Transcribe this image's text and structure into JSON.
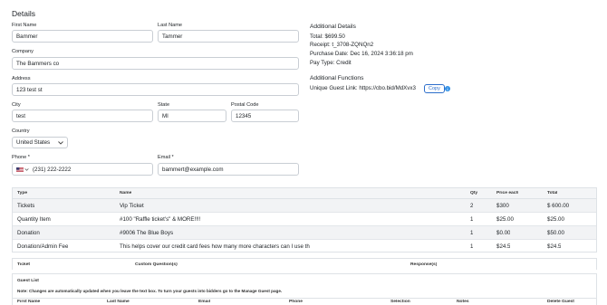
{
  "page": {
    "title": "Details"
  },
  "form": {
    "first_name": {
      "label": "First Name",
      "value": "Bammer"
    },
    "last_name": {
      "label": "Last Name",
      "value": "Tammer"
    },
    "company": {
      "label": "Company",
      "value": "The Bammers co"
    },
    "address": {
      "label": "Address",
      "value": "123 test st"
    },
    "city": {
      "label": "City",
      "value": "test"
    },
    "state": {
      "label": "State",
      "value": "MI"
    },
    "postal": {
      "label": "Postal Code",
      "value": "12345"
    },
    "country": {
      "label": "Country",
      "value": "United States"
    },
    "phone": {
      "label": "Phone *",
      "value": "(231) 222-2222"
    },
    "email": {
      "label": "Email *",
      "value": "bammert@example.com"
    }
  },
  "additional_details": {
    "heading": "Additional Details",
    "total": "Total: $699.50",
    "receipt": "Receipt: t_3708-ZQNQn2",
    "purchase_date": "Purchase Date: Dec 16, 2024 3:36:18 pm",
    "pay_type": "Pay Type: Credit"
  },
  "additional_functions": {
    "heading": "Additional Functions",
    "guest_link": "Unique Guest Link: https://cbo.bid/MdXvx3",
    "copy_label": "Copy",
    "info": "i"
  },
  "items_table": {
    "headers": [
      "Type",
      "Name",
      "Qty",
      "Price each",
      "Total"
    ],
    "rows": [
      [
        "Tickets",
        "Vip Ticket",
        "2",
        "$300",
        "$ 600.00"
      ],
      [
        "Quantity Item",
        "#100 \"Raffle ticket's\" & MORE!!!!",
        "1",
        "$25.00",
        "$25.00"
      ],
      [
        "Donation",
        "#9006 The Blue Boys",
        "1",
        "$0.00",
        "$50.00"
      ],
      [
        "Donation/Admin Fee",
        "This helps cover our credit card fees how many more characters can I use th",
        "1",
        "$24.5",
        "$24.5"
      ]
    ]
  },
  "questions_table": {
    "headers": [
      "Ticket",
      "Custom Question(s)",
      "Response(s)"
    ]
  },
  "guest_list": {
    "heading": "Guest List",
    "note": "Note: Changes are automatically updated when you leave the text box. To turn your guests into bidders go to the Manage Guest page.",
    "headers": [
      "First Name",
      "Last Name",
      "Email",
      "Phone",
      "Selection",
      "Notes",
      "Delete Guest"
    ]
  }
}
